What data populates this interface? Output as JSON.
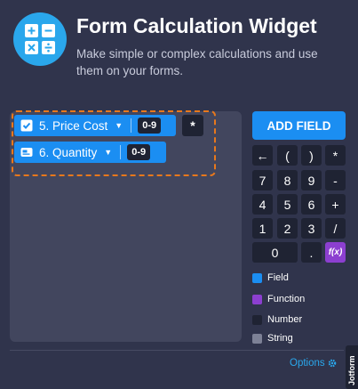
{
  "header": {
    "title": "Form Calculation Widget",
    "subtitle": "Make simple or complex calculations and use them on your forms.",
    "logo_icon": "calculator-icon"
  },
  "formula": {
    "fields": [
      {
        "label": "5. Price Cost",
        "badge": "0-9",
        "icon": "checkbox-icon"
      },
      {
        "label": "6. Quantity",
        "badge": "0-9",
        "icon": "card-icon"
      }
    ],
    "operator": "*"
  },
  "toolbar": {
    "add_field_label": "ADD FIELD"
  },
  "keypad": {
    "rows": [
      [
        "←",
        "(",
        ")",
        "*"
      ],
      [
        "7",
        "8",
        "9",
        "-"
      ],
      [
        "4",
        "5",
        "6",
        "+"
      ],
      [
        "1",
        "2",
        "3",
        "/"
      ]
    ],
    "last_row": [
      "0",
      ".",
      "f(x)"
    ]
  },
  "legend": [
    {
      "label": "Field",
      "color": "#1b8ef2"
    },
    {
      "label": "Function",
      "color": "#8c3fd0"
    },
    {
      "label": "Number",
      "color": "#1f2333"
    },
    {
      "label": "String",
      "color": "#7d8196"
    }
  ],
  "footer": {
    "options_label": "Options",
    "brand": "Jotform"
  },
  "colors": {
    "background": "#30344c",
    "accent": "#1b8ef2",
    "function": "#8c3fd0",
    "dashed_border": "#e8781c"
  }
}
